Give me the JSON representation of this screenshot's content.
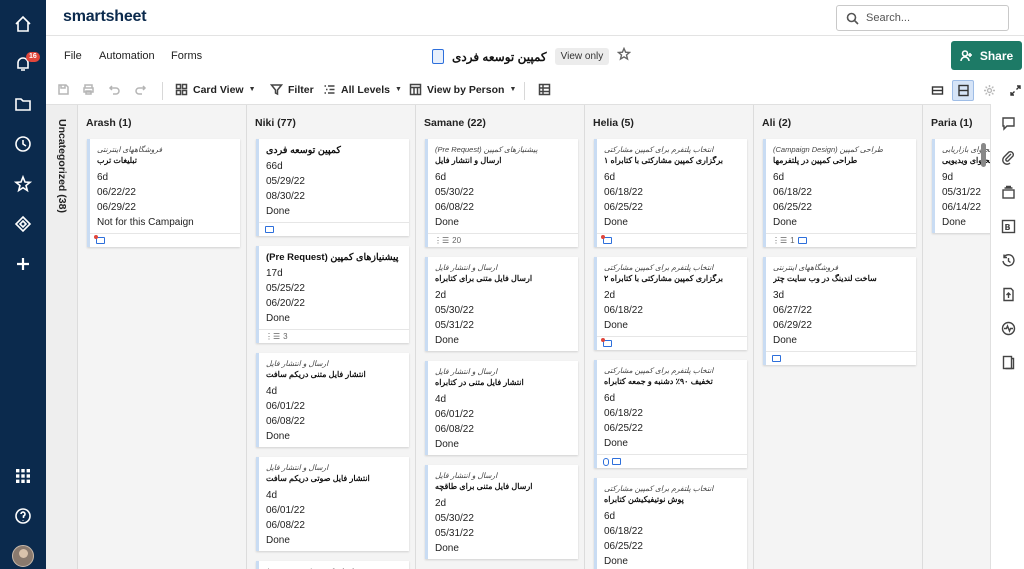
{
  "app": {
    "logo": "smartsheet",
    "notification_count": "16"
  },
  "search": {
    "placeholder": "Search..."
  },
  "menu": {
    "file": "File",
    "automation": "Automation",
    "forms": "Forms"
  },
  "sheet": {
    "title": "کمپین توسعه فردی",
    "view_only": "View only"
  },
  "share_label": "Share",
  "toolbar": {
    "card_view": "Card View",
    "filter": "Filter",
    "all_levels": "All Levels",
    "view_by": "View by Person"
  },
  "board": {
    "uncategorized": "Uncategorized (38)",
    "lanes": [
      {
        "name": "Arash (1)",
        "cards": [
          {
            "pre": "فروشگاههای اینترنتی",
            "title": "تبلیغات ترب",
            "values": [
              "6d",
              "06/22/22",
              "06/29/22",
              "Not for this Campaign"
            ],
            "foot": "comment-dot"
          }
        ]
      },
      {
        "name": "Niki (77)",
        "cards": [
          {
            "pre": "",
            "title": "کمپین توسعه فردی",
            "values": [
              "66d",
              "05/29/22",
              "08/30/22",
              "Done"
            ],
            "foot": "comment"
          },
          {
            "pre": "",
            "title": "(Pre Request) پیشنیازهای کمپین",
            "values": [
              "17d",
              "05/25/22",
              "06/20/22",
              "Done"
            ],
            "foot": "list",
            "foot_count": "3"
          },
          {
            "pre": "ارسال و انتشار فایل",
            "title": "انتشار فایل متنی دریکم سافت",
            "values": [
              "4d",
              "06/01/22",
              "06/08/22",
              "Done"
            ],
            "foot": ""
          },
          {
            "pre": "ارسال و انتشار فایل",
            "title": "انتشار فایل صوتی دریکم سافت",
            "values": [
              "4d",
              "06/01/22",
              "06/08/22",
              "Done"
            ],
            "foot": ""
          },
          {
            "pre": "(Pre Request) پیشنیازهای کمپین",
            "title": "",
            "values": [],
            "foot": ""
          }
        ]
      },
      {
        "name": "Samane (22)",
        "cards": [
          {
            "pre": "(Pre Request) پیشنیازهای کمپین",
            "title": "ارسال و انتشار فایل",
            "values": [
              "6d",
              "05/30/22",
              "06/08/22",
              "Done"
            ],
            "foot": "list",
            "foot_count": "20"
          },
          {
            "pre": "ارسال و انتشار فایل",
            "title": "ارسال فایل متنی برای کتابراه",
            "values": [
              "2d",
              "05/30/22",
              "05/31/22",
              "Done"
            ],
            "foot": ""
          },
          {
            "pre": "ارسال و انتشار فایل",
            "title": "انتشار فایل متنی در کتابراه",
            "values": [
              "4d",
              "06/01/22",
              "06/08/22",
              "Done"
            ],
            "foot": ""
          },
          {
            "pre": "ارسال و انتشار فایل",
            "title": "ارسال فایل متنی برای طاقچه",
            "values": [
              "2d",
              "05/30/22",
              "05/31/22",
              "Done"
            ],
            "foot": ""
          }
        ]
      },
      {
        "name": "Helia (5)",
        "cards": [
          {
            "pre": "انتخاب پلتفرم برای کمپین مشارکتی",
            "title": "برگزاری کمپین مشارکتی با کتابراه ۱",
            "values": [
              "6d",
              "06/18/22",
              "06/25/22",
              "Done"
            ],
            "foot": "comment-dot"
          },
          {
            "pre": "انتخاب پلتفرم برای کمپین مشارکتی",
            "title": "برگزاری کمپین مشارکتی با کتابراه ۲",
            "values": [
              "2d",
              "06/18/22",
              "Done"
            ],
            "foot": "comment-dot"
          },
          {
            "pre": "انتخاب پلتفرم برای کمپین مشارکتی",
            "title": "تخفیف ۹۰٪ دشنبه و جمعه کتابراه",
            "values": [
              "6d",
              "06/18/22",
              "06/25/22",
              "Done"
            ],
            "foot": "clip-comment"
          },
          {
            "pre": "انتخاب پلتفرم برای کمپین مشارکتی",
            "title": "پوش نوتیفیکیشن کتابراه",
            "values": [
              "6d",
              "06/18/22",
              "06/25/22",
              "Done"
            ],
            "foot": ""
          }
        ]
      },
      {
        "name": "Ali (2)",
        "cards": [
          {
            "pre": "(Campaign Design) طراحی کمپین",
            "title": "طراحی کمپین در پلتفرمها",
            "values": [
              "6d",
              "06/18/22",
              "06/25/22",
              "Done"
            ],
            "foot": "list-comment",
            "foot_count": "1"
          },
          {
            "pre": "فروشگاههای اینترنتی",
            "title": "ساخت لندینگ در وب سایت چتر",
            "values": [
              "3d",
              "06/27/22",
              "06/29/22",
              "Done"
            ],
            "foot": "comment"
          }
        ]
      },
      {
        "name": "Paria (1)",
        "cards": [
          {
            "pre": "تولید محتوای بازاریابی",
            "title": "محتوای ویدیویی",
            "values": [
              "9d",
              "05/31/22",
              "06/14/22",
              "Done"
            ],
            "foot": ""
          }
        ]
      }
    ]
  }
}
